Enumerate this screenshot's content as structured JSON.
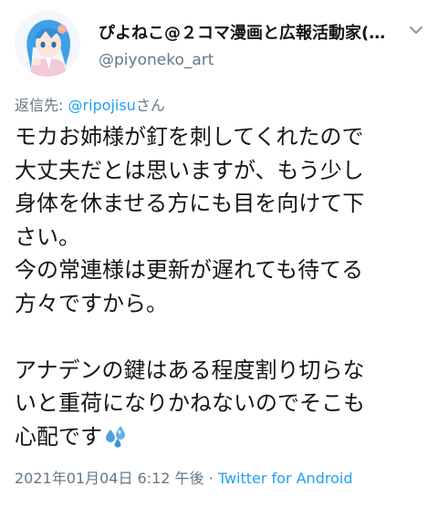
{
  "user": {
    "display_name": "ぴよねこ@２コマ漫画と広報活動家(…",
    "handle": "@piyoneko_art",
    "avatar_icon": "avatar-illustration-icon"
  },
  "menu": {
    "icon": "chevron-down-icon"
  },
  "reply": {
    "prefix": "返信先: ",
    "mention": "@ripojisu",
    "suffix": "さん"
  },
  "tweet": {
    "lines": [
      "モカお姉様が釘を刺してくれたので",
      "大丈夫だとは思いますが、もう少し",
      "身体を休ませる方にも目を向けて下",
      "さい。",
      "今の常連様は更新が遅れても待てる",
      "方々ですから。",
      "",
      "アナデンの鍵はある程度割り切らな",
      "いと重荷になりかねないのでそこも",
      "心配です"
    ],
    "emoji": "sweat-droplets-icon"
  },
  "meta": {
    "timestamp": "2021年01月04日 6:12 午後",
    "separator": " · ",
    "client": "Twitter for Android"
  },
  "colors": {
    "text": "#14171a",
    "secondary": "#657786",
    "accent": "#1da1f2"
  }
}
